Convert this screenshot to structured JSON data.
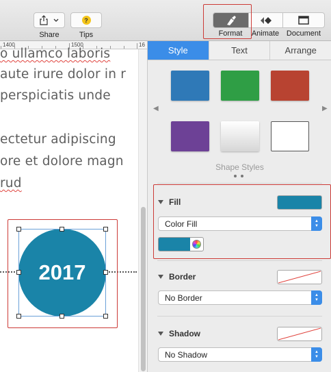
{
  "toolbar": {
    "share_label": "Share",
    "tips_label": "Tips",
    "format_label": "Format",
    "animate_label": "Animate",
    "document_label": "Document"
  },
  "ruler": {
    "labels": [
      "1400",
      "1500",
      "16"
    ]
  },
  "document": {
    "lines": [
      "o ullamco laboris",
      "aute irure dolor in r",
      "perspiciatis unde",
      "ectetur adipiscing",
      "ore et dolore magn",
      "rud"
    ],
    "shape_text": "2017"
  },
  "inspector": {
    "tabs": [
      "Style",
      "Text",
      "Arrange"
    ],
    "active_tab": "Style",
    "shape_styles_label": "Shape Styles",
    "fill": {
      "label": "Fill",
      "type": "Color Fill",
      "color": "#1a84a8"
    },
    "border": {
      "label": "Border",
      "type": "No Border"
    },
    "shadow": {
      "label": "Shadow",
      "type": "No Shadow"
    }
  },
  "colors": {
    "accent": "#3b8de8",
    "highlight_box": "#cc3a36",
    "swatches": [
      "#2f79b7",
      "#2f9e45",
      "#b84331",
      "#6d4196",
      "#e6e6e6",
      "#ffffff"
    ]
  }
}
